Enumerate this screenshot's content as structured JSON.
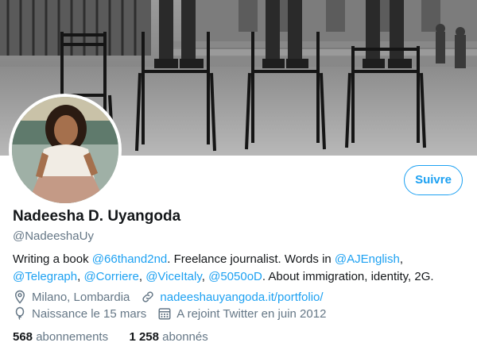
{
  "profile": {
    "name": "Nadeesha D. Uyangoda",
    "handle": "@NadeeshaUy",
    "follow_label": "Suivre",
    "bio": {
      "t1": "Writing a book ",
      "l1": "@66thand2nd",
      "t2": ". Freelance journalist. Words in ",
      "l2": "@AJEnglish",
      "t3": ", ",
      "l3": "@Telegraph",
      "t4": ", ",
      "l4": "@Corriere",
      "t5": ", ",
      "l5": "@ViceItaly",
      "t6": ", ",
      "l6": "@5050oD",
      "t7": ". About immigration, identity, 2G."
    },
    "location": "Milano, Lombardia",
    "website": "nadeeshauyangoda.it/portfolio/",
    "birthday": "Naissance le 15 mars",
    "joined": "A rejoint Twitter en juin 2012",
    "following_count": "568",
    "following_label": "abonnements",
    "followers_count": "1 258",
    "followers_label": "abonnés"
  },
  "icons": {
    "location": "location-pin-icon",
    "website": "link-icon",
    "birthday": "balloon-icon",
    "joined": "calendar-icon"
  },
  "colors": {
    "accent": "#1da1f2",
    "secondary_text": "#657786",
    "primary_text": "#14171a"
  }
}
